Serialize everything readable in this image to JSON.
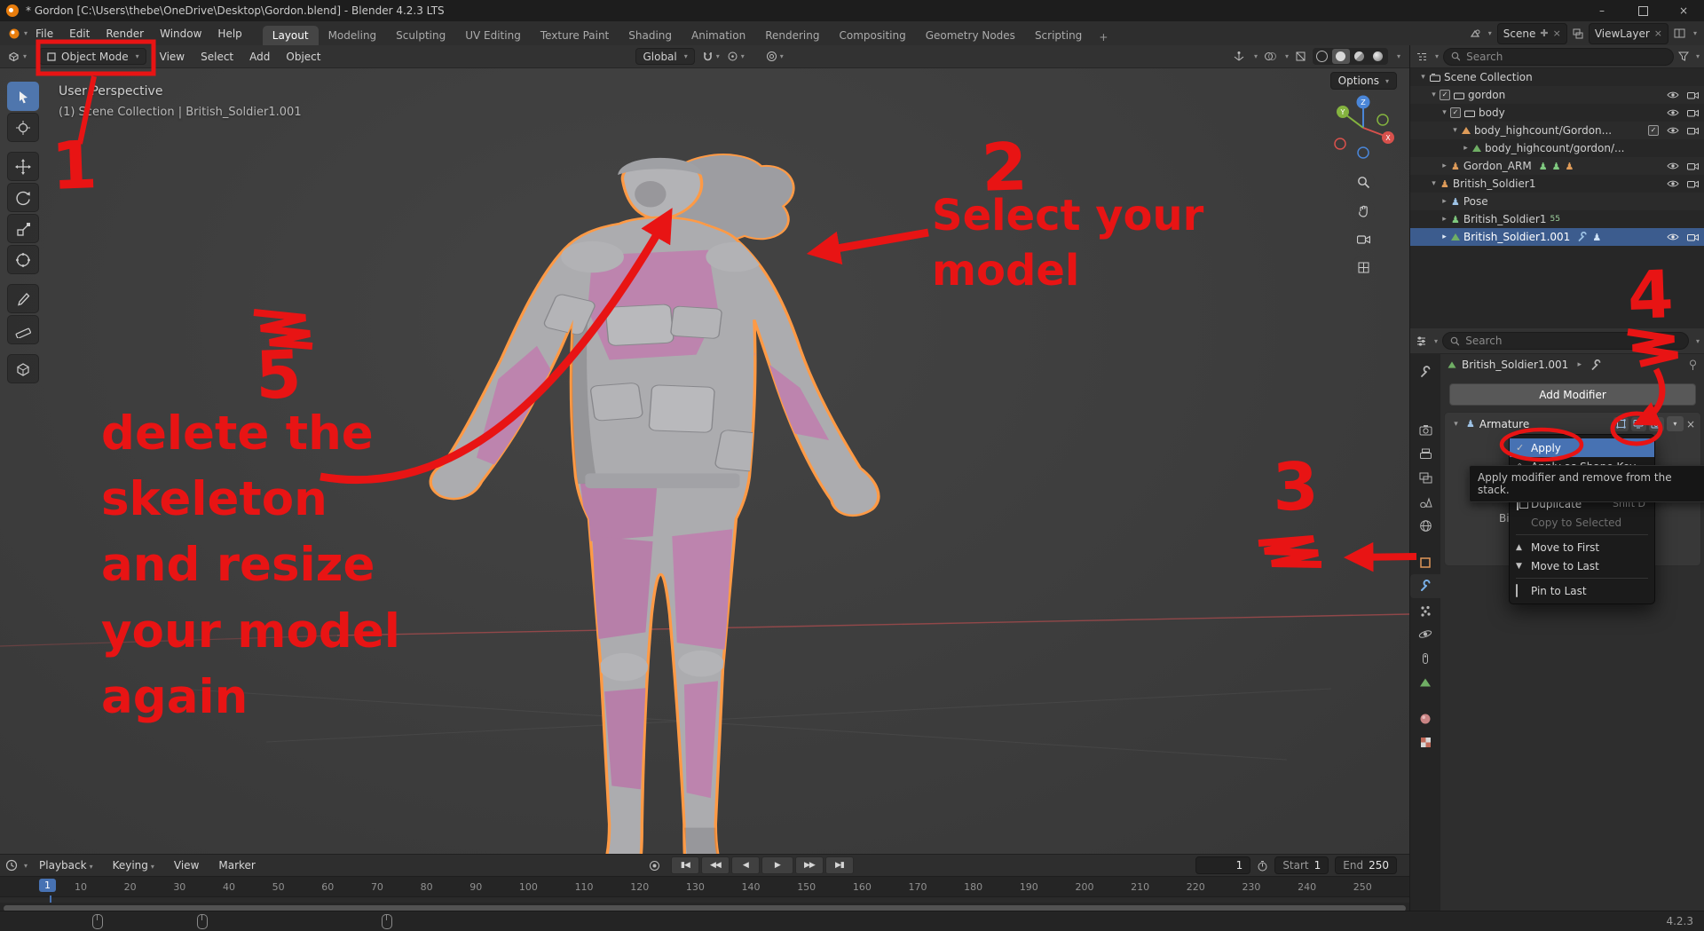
{
  "window": {
    "title": "* Gordon [C:\\Users\\thebe\\OneDrive\\Desktop\\Gordon.blend] - Blender 4.2.3 LTS"
  },
  "topbar": {
    "menus": [
      "File",
      "Edit",
      "Render",
      "Window",
      "Help"
    ],
    "tabs": [
      "Layout",
      "Modeling",
      "Sculpting",
      "UV Editing",
      "Texture Paint",
      "Shading",
      "Animation",
      "Rendering",
      "Compositing",
      "Geometry Nodes",
      "Scripting"
    ],
    "new_tab": "+",
    "scene": "Scene",
    "viewlayer": "ViewLayer"
  },
  "viewport_header": {
    "mode": "Object Mode",
    "menu_view": "View",
    "menu_select": "Select",
    "menu_add": "Add",
    "menu_object": "Object",
    "orientation": "Global",
    "options": "Options"
  },
  "viewport_overlay": {
    "line1": "User Perspective",
    "line2": "(1) Scene Collection | British_Soldier1.001",
    "axis_x": "X",
    "axis_y": "Y",
    "axis_z": "Z"
  },
  "outliner": {
    "search_placeholder": "Search",
    "rows": [
      {
        "label": "Scene Collection"
      },
      {
        "label": "gordon"
      },
      {
        "label": "body"
      },
      {
        "label": "body_highcount/Gordon..."
      },
      {
        "label": "body_highcount/gordon/..."
      },
      {
        "label": "Gordon_ARM"
      },
      {
        "label": "British_Soldier1"
      },
      {
        "label": "Pose"
      },
      {
        "label": "British_Soldier1",
        "badge": "55"
      },
      {
        "label": "British_Soldier1.001"
      }
    ]
  },
  "properties": {
    "search_placeholder": "Search",
    "breadcrumb": "British_Soldier1.001",
    "add_modifier": "Add Modifier",
    "modifier_name": "Armature",
    "partial_label": "Bi"
  },
  "context_menu": {
    "apply": "Apply",
    "apply_shape": "Apply as Shape Key",
    "duplicate": "Duplicate",
    "duplicate_shortcut": "Shift D",
    "copy_selected": "Copy to Selected",
    "move_first": "Move to First",
    "move_last": "Move to Last",
    "pin_last": "Pin to Last"
  },
  "tooltip": {
    "text": "Apply modifier and remove from the stack."
  },
  "timeline": {
    "menu_playback": "Playback",
    "menu_keying": "Keying",
    "menu_view": "View",
    "menu_marker": "Marker",
    "current_frame": "1",
    "frame_value": "1",
    "start_label": "Start",
    "start_value": "1",
    "end_label": "End",
    "end_value": "250",
    "ticks": [
      "10",
      "20",
      "30",
      "40",
      "50",
      "60",
      "70",
      "80",
      "90",
      "100",
      "110",
      "120",
      "130",
      "140",
      "150",
      "160",
      "170",
      "180",
      "190",
      "200",
      "210",
      "220",
      "230",
      "240",
      "250"
    ]
  },
  "statusbar": {
    "version": "4.2.3"
  },
  "annotations": {
    "n1": "1",
    "n2": "2",
    "n3": "3",
    "n4": "4",
    "n5": "5",
    "select1": "Select your",
    "select2": "model",
    "d0": "delete the",
    "d1": "skeleton",
    "d2": "and resize",
    "d3": "your model",
    "d4": "again"
  }
}
